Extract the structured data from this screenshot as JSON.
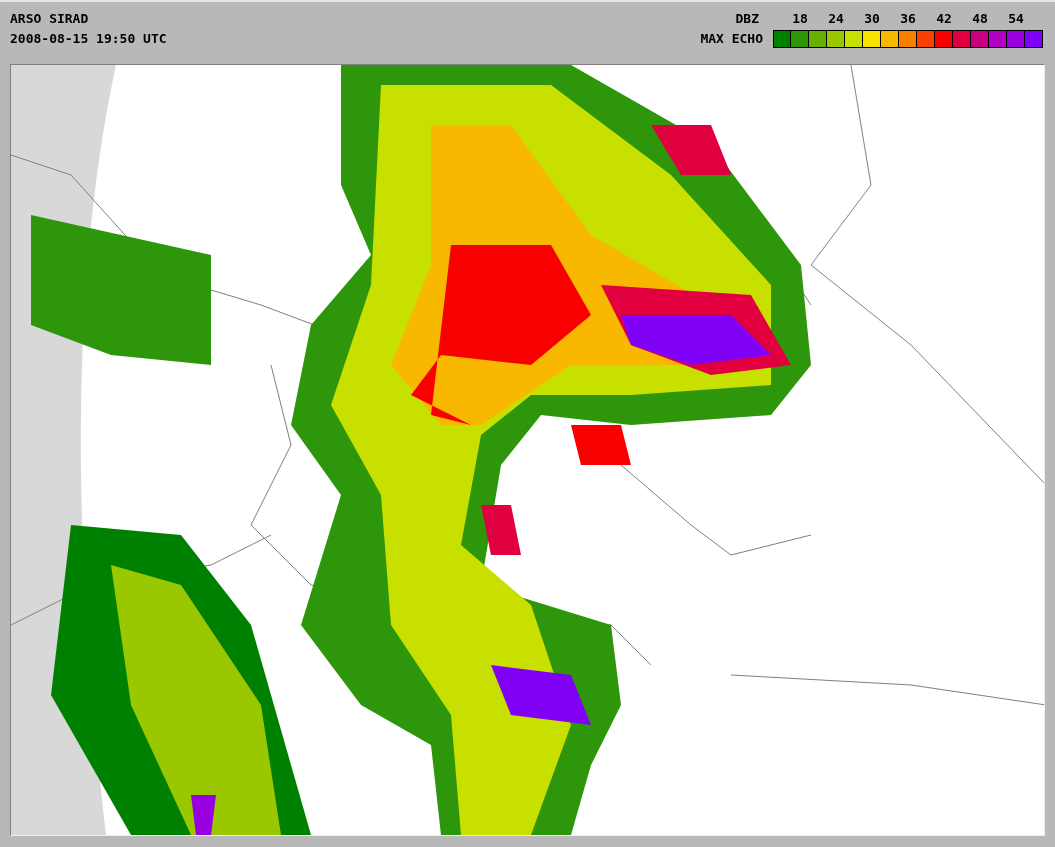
{
  "header": {
    "title": "ARSO SIRAD",
    "timestamp": "2008-08-15 19:50 UTC"
  },
  "legend": {
    "unit": "DBZ",
    "label": "MAX ECHO",
    "scale_labels": [
      "18",
      "24",
      "30",
      "36",
      "42",
      "48",
      "54"
    ],
    "swatches": [
      {
        "color": "#008000"
      },
      {
        "color": "#2e960a"
      },
      {
        "color": "#66b000"
      },
      {
        "color": "#99c800"
      },
      {
        "color": "#c8e000"
      },
      {
        "color": "#f8e000"
      },
      {
        "color": "#f8b800"
      },
      {
        "color": "#f88000"
      },
      {
        "color": "#f84000"
      },
      {
        "color": "#f80000"
      },
      {
        "color": "#e00040"
      },
      {
        "color": "#c80080"
      },
      {
        "color": "#b000c0"
      },
      {
        "color": "#9800e0"
      },
      {
        "color": "#8000f8"
      }
    ]
  }
}
